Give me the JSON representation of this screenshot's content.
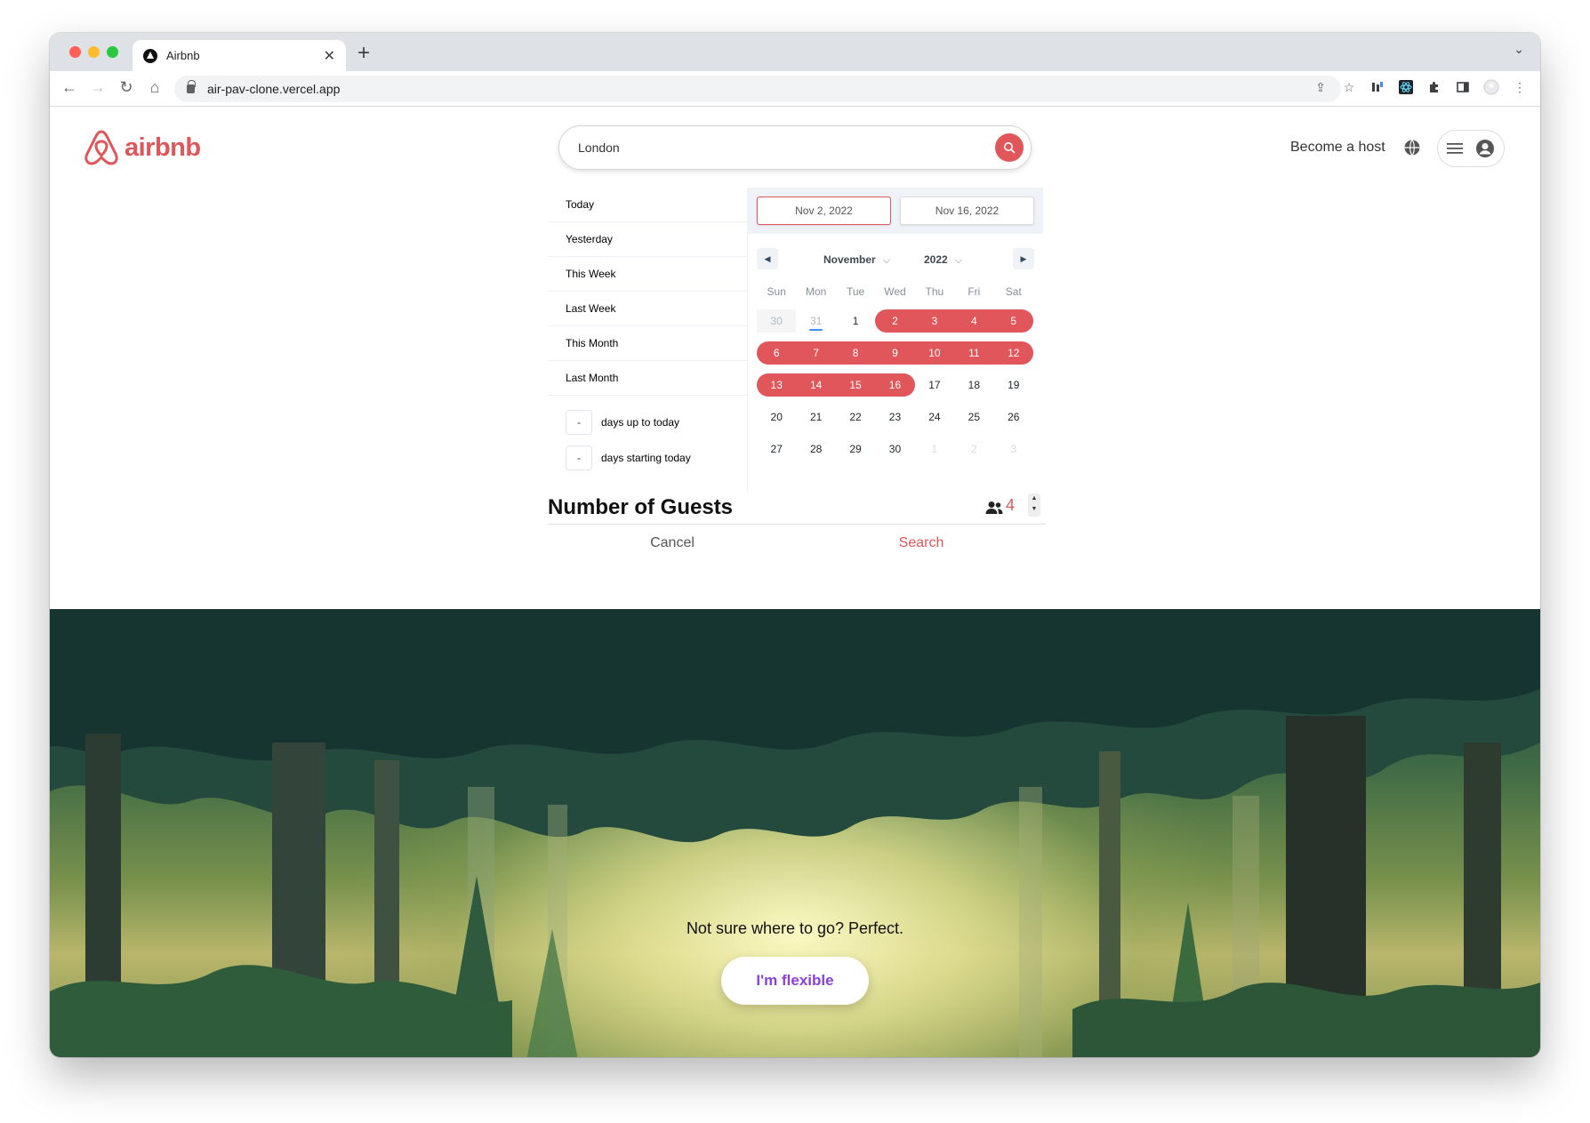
{
  "browser": {
    "tab_title": "Airbnb",
    "new_tab_label": "+",
    "url": "air-pav-clone.vercel.app"
  },
  "header": {
    "logo_text": "airbnb",
    "search_value": "London",
    "become_host": "Become a host"
  },
  "date_picker": {
    "static_ranges": [
      "Today",
      "Yesterday",
      "This Week",
      "Last Week",
      "This Month",
      "Last Month"
    ],
    "input_ranges": [
      {
        "value": "-",
        "label": "days up to today"
      },
      {
        "value": "-",
        "label": "days starting today"
      }
    ],
    "start_date": "Nov 2, 2022",
    "end_date": "Nov 16, 2022",
    "month": "November",
    "year": "2022",
    "weekdays": [
      "Sun",
      "Mon",
      "Tue",
      "Wed",
      "Thu",
      "Fri",
      "Sat"
    ],
    "weeks": [
      [
        "30",
        "31",
        "1",
        "2",
        "3",
        "4",
        "5"
      ],
      [
        "6",
        "7",
        "8",
        "9",
        "10",
        "11",
        "12"
      ],
      [
        "13",
        "14",
        "15",
        "16",
        "17",
        "18",
        "19"
      ],
      [
        "20",
        "21",
        "22",
        "23",
        "24",
        "25",
        "26"
      ],
      [
        "27",
        "28",
        "29",
        "30",
        "1",
        "2",
        "3"
      ]
    ],
    "accent_color": "#e0565b"
  },
  "guests": {
    "title": "Number of Guests",
    "count": "4"
  },
  "actions": {
    "cancel": "Cancel",
    "search": "Search"
  },
  "hero": {
    "tagline": "Not sure where to go? Perfect.",
    "button": "I'm flexible",
    "button_color": "#8b3fd9"
  }
}
